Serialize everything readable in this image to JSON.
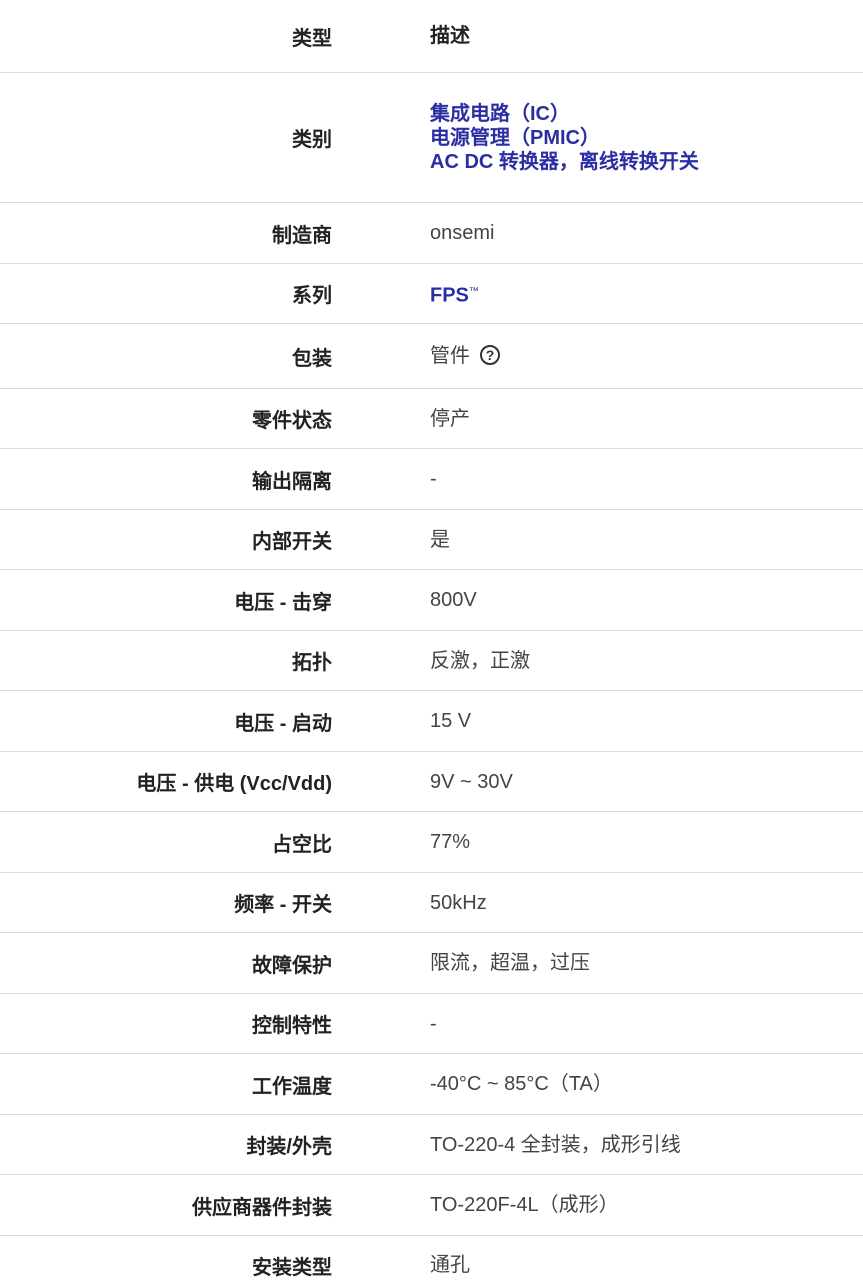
{
  "header": {
    "type_label": "类型",
    "desc_label": "描述"
  },
  "rows": [
    {
      "label": "类别",
      "links": [
        "集成电路（IC）",
        "电源管理（PMIC）",
        "AC DC 转换器，离线转换开关"
      ]
    },
    {
      "label": "制造商",
      "value": "onsemi"
    },
    {
      "label": "系列",
      "value": "FPS",
      "tm": "™"
    },
    {
      "label": "包装",
      "value": "管件",
      "help": "?"
    },
    {
      "label": "零件状态",
      "value": "停产"
    },
    {
      "label": "输出隔离",
      "value": "-"
    },
    {
      "label": "内部开关",
      "value": "是"
    },
    {
      "label": "电压 - 击穿",
      "value": "800V"
    },
    {
      "label": "拓扑",
      "value": "反激，正激"
    },
    {
      "label": "电压 - 启动",
      "value": "15 V"
    },
    {
      "label": "电压 - 供电 (Vcc/Vdd)",
      "value": "9V ~ 30V"
    },
    {
      "label": "占空比",
      "value": "77%"
    },
    {
      "label": "频率 - 开关",
      "value": "50kHz"
    },
    {
      "label": "故障保护",
      "value": "限流，超温，过压"
    },
    {
      "label": "控制特性",
      "value": "-"
    },
    {
      "label": "工作温度",
      "value": "-40°C ~ 85°C（TA）"
    },
    {
      "label": "封装/外壳",
      "value": "TO-220-4 全封装，成形引线"
    },
    {
      "label": "供应商器件封装",
      "value": "TO-220F-4L（成形）"
    },
    {
      "label": "安装类型",
      "value": "通孔"
    }
  ],
  "colors": {
    "link": "#2b2ea3",
    "border": "#dcdcdc",
    "label": "#222222",
    "value": "#444444"
  },
  "icons": {
    "help": "question-circle-icon"
  }
}
